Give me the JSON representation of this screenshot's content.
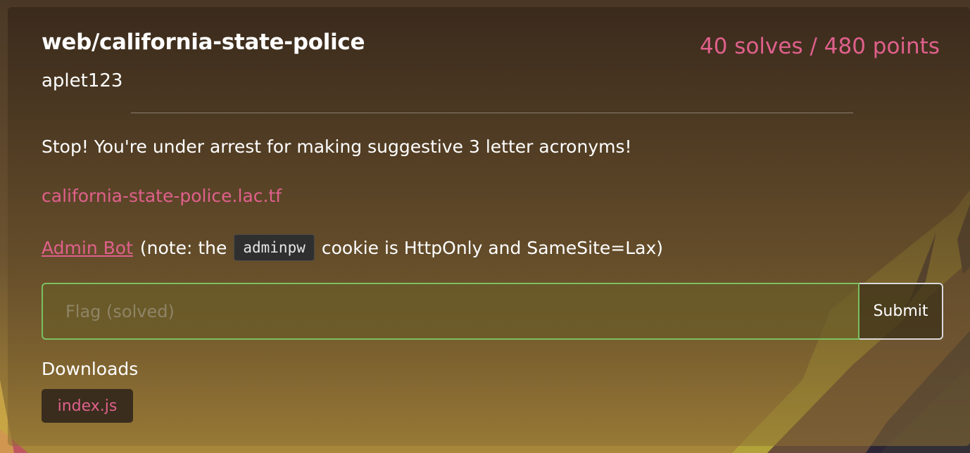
{
  "challenge": {
    "title": "web/california-state-police",
    "stats": "40 solves / 480 points",
    "author": "aplet123",
    "description": "Stop! You're under arrest for making suggestive 3 letter acronyms!",
    "link_text": "california-state-police.lac.tf",
    "note": {
      "admin_bot_label": "Admin Bot",
      "prefix": "(note: the",
      "code": "adminpw",
      "suffix": "cookie is HttpOnly and SameSite=Lax)"
    }
  },
  "flag_form": {
    "placeholder": "Flag (solved)",
    "value": "",
    "submit_label": "Submit",
    "status_color": "#7cc060"
  },
  "downloads": {
    "label": "Downloads",
    "files": [
      {
        "name": "index.js"
      }
    ]
  },
  "colors": {
    "accent": "#e0608c",
    "background": "#4a3826"
  }
}
